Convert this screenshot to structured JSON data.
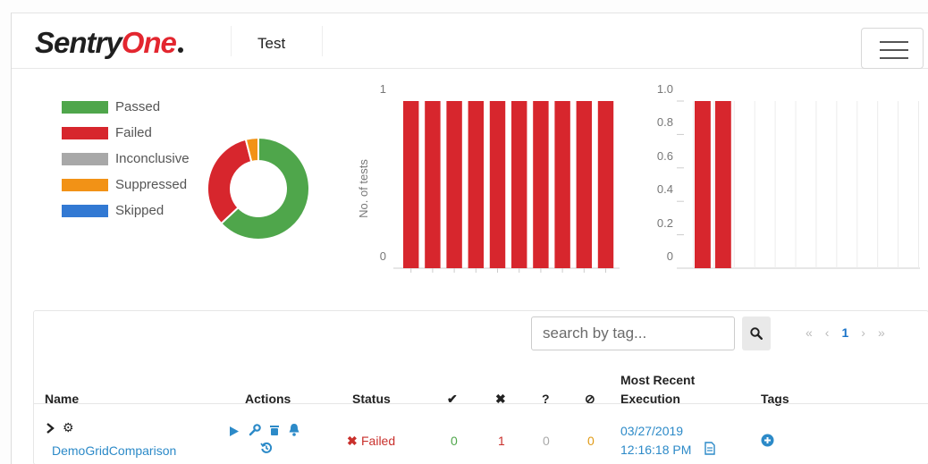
{
  "header": {
    "logo_part1": "Sentry",
    "logo_part2": "One",
    "title": "Test"
  },
  "legend": [
    {
      "label": "Passed",
      "color": "#4fa64b"
    },
    {
      "label": "Failed",
      "color": "#d7262d"
    },
    {
      "label": "Inconclusive",
      "color": "#a8a8a8"
    },
    {
      "label": "Suppressed",
      "color": "#f29216"
    },
    {
      "label": "Skipped",
      "color": "#3279d3"
    }
  ],
  "chart_data": [
    {
      "type": "pie",
      "categories": [
        "Passed",
        "Failed",
        "Suppressed"
      ],
      "values": [
        63,
        33,
        4
      ],
      "colors": [
        "#4fa64b",
        "#d7262d",
        "#f29216"
      ]
    },
    {
      "type": "bar",
      "ylabel": "No. of tests",
      "ytick_labels": [
        "1",
        "0"
      ],
      "ylim": [
        0,
        1
      ],
      "values": [
        1,
        1,
        1,
        1,
        1,
        1,
        1,
        1,
        1,
        1
      ],
      "color": "#d7262d"
    },
    {
      "type": "bar",
      "ytick_labels": [
        "1.0",
        "0.8",
        "0.6",
        "0.4",
        "0.2",
        "0"
      ],
      "ylim": [
        0,
        1
      ],
      "values": [
        1,
        1,
        0,
        0,
        0,
        0,
        0,
        0,
        0,
        0,
        0
      ],
      "color": "#d7262d",
      "grid": true
    }
  ],
  "table": {
    "search_placeholder": "search by tag...",
    "pager": {
      "first": "«",
      "prev": "‹",
      "current": "1",
      "next": "›",
      "last": "»"
    },
    "headers": {
      "name": "Name",
      "actions": "Actions",
      "status": "Status",
      "passed": "✔",
      "failed": "✖",
      "inconclusive": "?",
      "suppressed": "⊘",
      "most_recent_1": "Most Recent",
      "most_recent_2": "Execution",
      "tags": "Tags"
    },
    "rows": [
      {
        "name": "DemoGridComparison",
        "status": "Failed",
        "passed": "0",
        "failed": "1",
        "inconclusive": "0",
        "suppressed": "0",
        "date": "03/27/2019",
        "time": "12:16:18 PM"
      }
    ]
  }
}
